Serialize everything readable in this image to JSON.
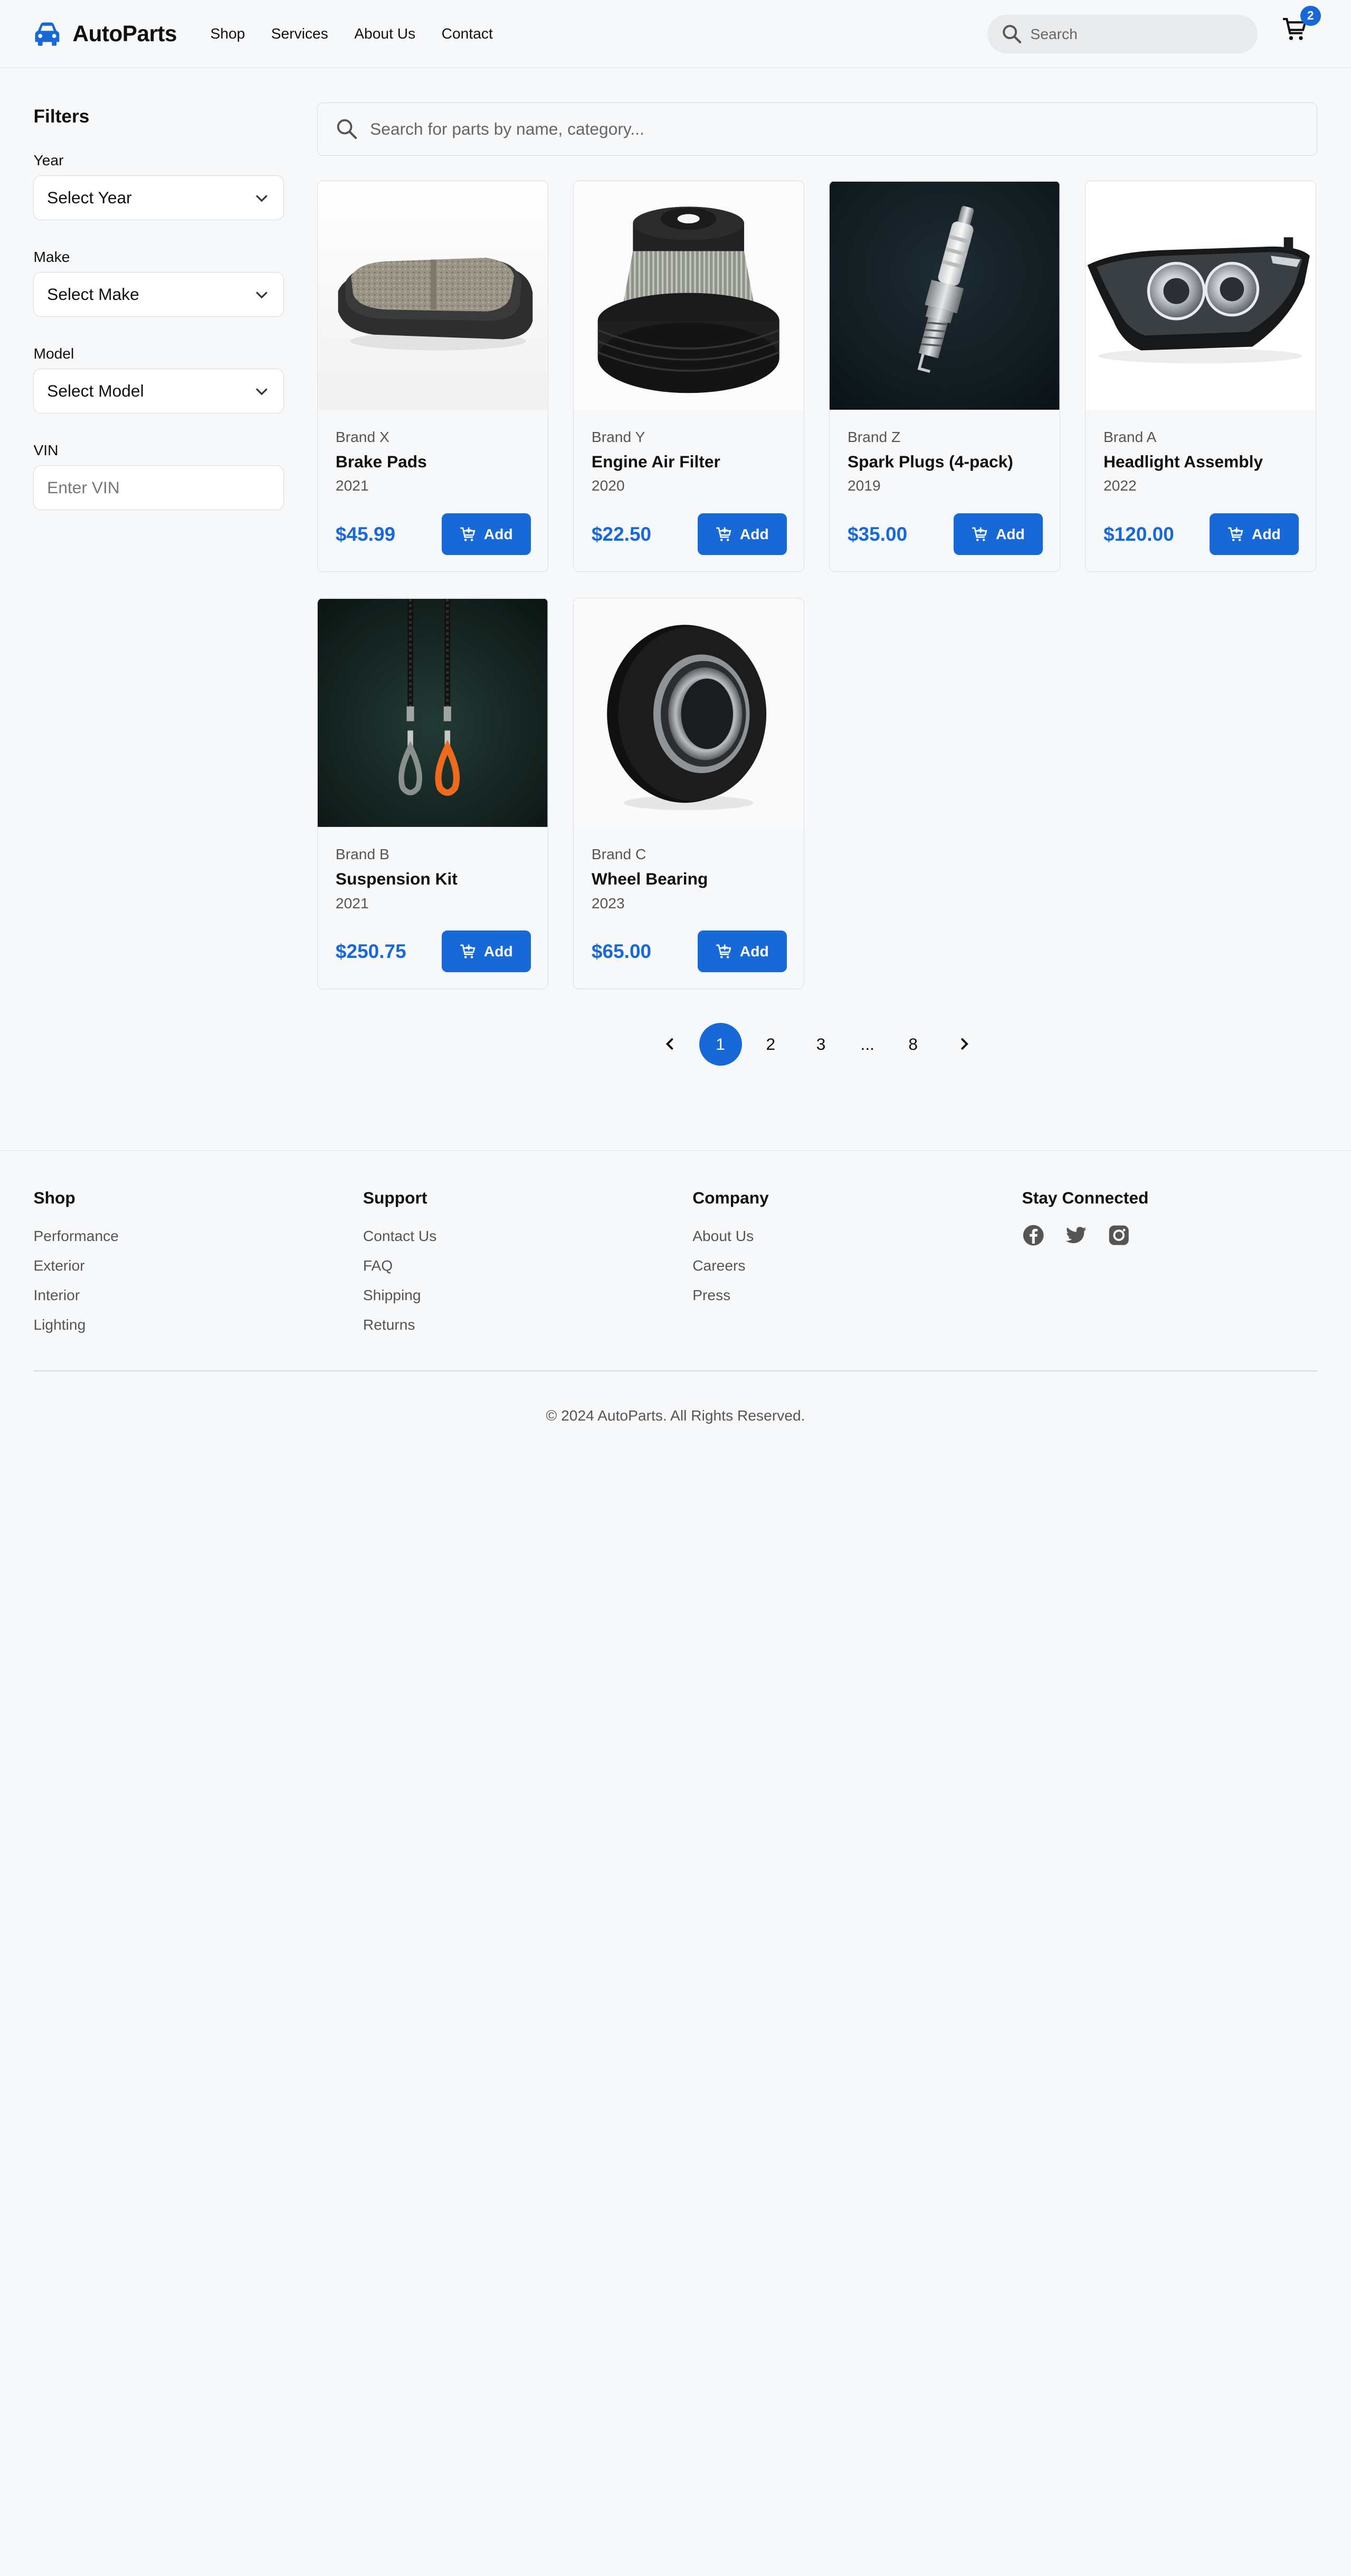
{
  "header": {
    "brand": "AutoParts",
    "nav": [
      "Shop",
      "Services",
      "About Us",
      "Contact"
    ],
    "search_placeholder": "Search",
    "cart_count": "2",
    "accent": "#1769d8"
  },
  "filters": {
    "title": "Filters",
    "year_label": "Year",
    "year_value": "Select Year",
    "make_label": "Make",
    "make_value": "Select Make",
    "model_label": "Model",
    "model_value": "Select Model",
    "vin_label": "VIN",
    "vin_placeholder": "Enter VIN"
  },
  "main_search_placeholder": "Search for parts by name, category...",
  "products": [
    {
      "brand": "Brand X",
      "name": "Brake Pads",
      "year": "2021",
      "price": "$45.99",
      "add": "Add",
      "image": "brake-pads"
    },
    {
      "brand": "Brand Y",
      "name": "Engine Air Filter",
      "year": "2020",
      "price": "$22.50",
      "add": "Add",
      "image": "air-filter"
    },
    {
      "brand": "Brand Z",
      "name": "Spark Plugs (4-pack)",
      "year": "2019",
      "price": "$35.00",
      "add": "Add",
      "image": "spark-plug"
    },
    {
      "brand": "Brand A",
      "name": "Headlight Assembly",
      "year": "2022",
      "price": "$120.00",
      "add": "Add",
      "image": "headlight"
    },
    {
      "brand": "Brand B",
      "name": "Suspension Kit",
      "year": "2021",
      "price": "$250.75",
      "add": "Add",
      "image": "suspension-kit"
    },
    {
      "brand": "Brand C",
      "name": "Wheel Bearing",
      "year": "2023",
      "price": "$65.00",
      "add": "Add",
      "image": "wheel-bearing"
    }
  ],
  "pagination": {
    "pages": [
      "1",
      "2",
      "3",
      "...",
      "8"
    ],
    "current": "1"
  },
  "footer": {
    "shop": {
      "title": "Shop",
      "links": [
        "Performance",
        "Exterior",
        "Interior",
        "Lighting"
      ]
    },
    "support": {
      "title": "Support",
      "links": [
        "Contact Us",
        "FAQ",
        "Shipping",
        "Returns"
      ]
    },
    "company": {
      "title": "Company",
      "links": [
        "About Us",
        "Careers",
        "Press"
      ]
    },
    "connected": {
      "title": "Stay Connected",
      "icons": [
        "facebook-icon",
        "twitter-icon",
        "instagram-icon"
      ]
    },
    "copyright": "© 2024 AutoParts. All Rights Reserved."
  }
}
